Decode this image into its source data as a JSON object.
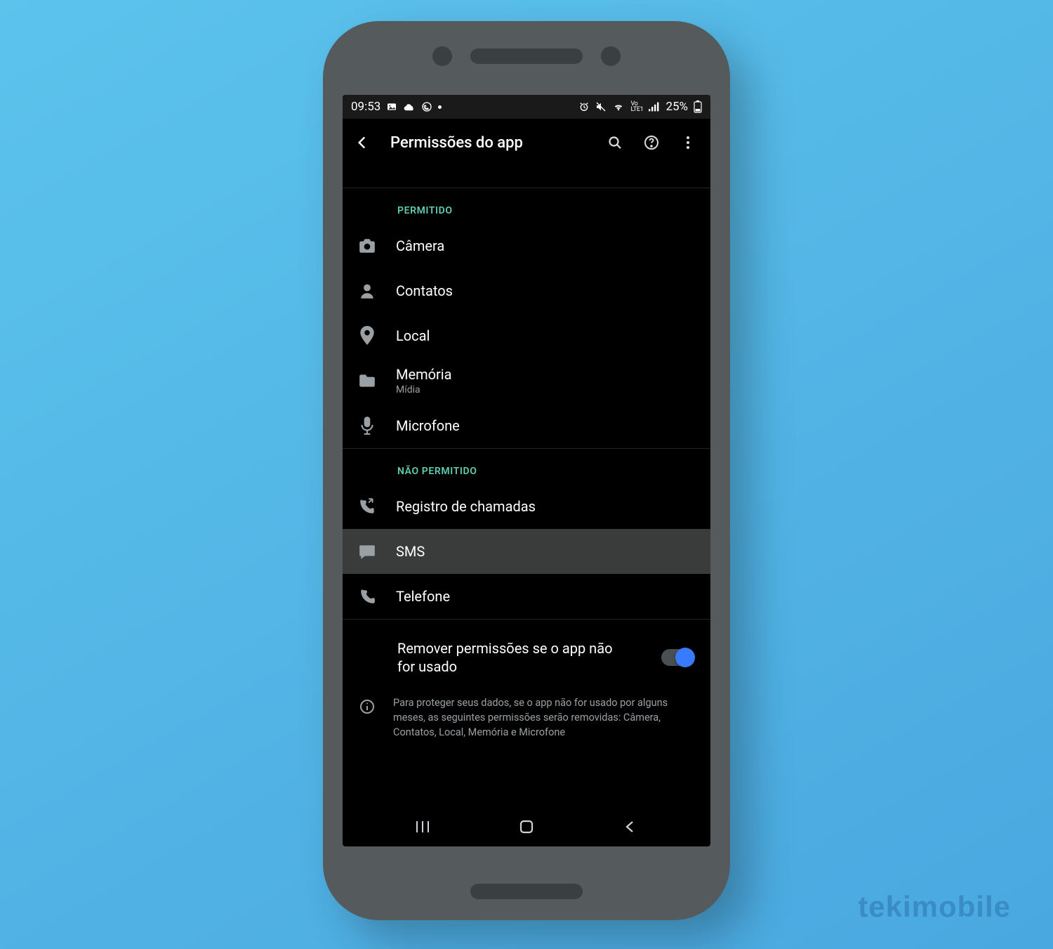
{
  "statusbar": {
    "time": "09:53",
    "battery_pct": "25%"
  },
  "appbar": {
    "title": "Permissões do app"
  },
  "sections": {
    "allowed_label": "PERMITIDO",
    "denied_label": "NÃO PERMITIDO"
  },
  "permissions_allowed": [
    {
      "icon": "camera-icon",
      "label": "Câmera",
      "sub": ""
    },
    {
      "icon": "contacts-icon",
      "label": "Contatos",
      "sub": ""
    },
    {
      "icon": "location-icon",
      "label": "Local",
      "sub": ""
    },
    {
      "icon": "storage-icon",
      "label": "Memória",
      "sub": "Mídia"
    },
    {
      "icon": "microphone-icon",
      "label": "Microfone",
      "sub": ""
    }
  ],
  "permissions_denied": [
    {
      "icon": "calllog-icon",
      "label": "Registro de chamadas",
      "highlight": false
    },
    {
      "icon": "sms-icon",
      "label": "SMS",
      "highlight": true
    },
    {
      "icon": "phone-icon",
      "label": "Telefone",
      "highlight": false
    }
  ],
  "toggle": {
    "label": "Remover permissões se o app não for usado",
    "on": true
  },
  "info_text": "Para proteger seus dados, se o app não for usado por alguns meses, as seguintes permissões serão removidas: Câmera, Contatos, Local, Memória e Microfone",
  "watermark": "tekimobile"
}
